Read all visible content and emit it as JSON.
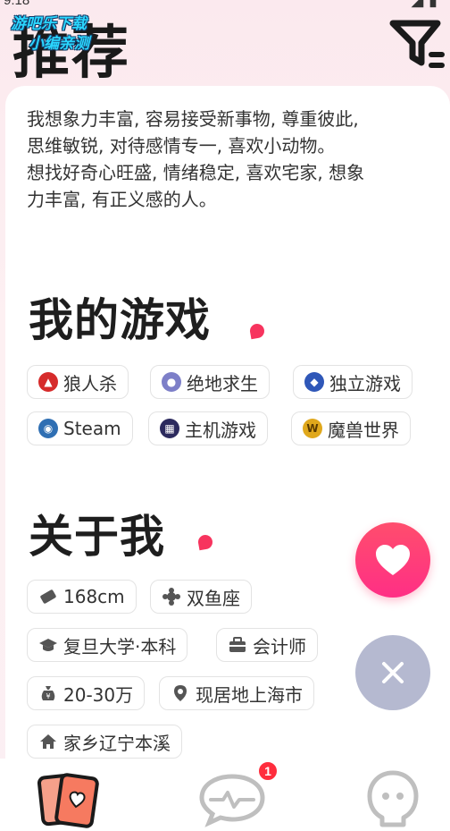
{
  "status_bar": {
    "time": "9:18"
  },
  "watermark": {
    "line1": "游吧乐下载",
    "line2": "小编亲测"
  },
  "header": {
    "title": "推荐"
  },
  "bio": {
    "line1": "我想象力丰富, 容易接受新事物, 尊重彼此,",
    "line2": "思维敏锐, 对待感情专一, 喜欢小动物。",
    "line3": "想找好奇心旺盛, 情绪稳定, 喜欢宅家, 想象",
    "line4": "力丰富, 有正义感的人。"
  },
  "games": {
    "title": "我的游戏",
    "tags": [
      {
        "label": "狼人杀",
        "icon": "werewolf-icon"
      },
      {
        "label": "绝地求生",
        "icon": "pubg-icon"
      },
      {
        "label": "独立游戏",
        "icon": "indie-game-icon"
      },
      {
        "label": "Steam",
        "icon": "steam-icon"
      },
      {
        "label": "主机游戏",
        "icon": "console-game-icon"
      },
      {
        "label": "魔兽世界",
        "icon": "warcraft-icon"
      }
    ]
  },
  "about": {
    "title": "关于我",
    "tags": [
      {
        "label": "168cm",
        "icon": "ruler-icon"
      },
      {
        "label": "双鱼座",
        "icon": "zodiac-icon"
      },
      {
        "label": "复旦大学·本科",
        "icon": "graduation-cap-icon"
      },
      {
        "label": "会计师",
        "icon": "briefcase-icon"
      },
      {
        "label": "20-30万",
        "icon": "money-bag-icon"
      },
      {
        "label": "现居地上海市",
        "icon": "location-pin-icon"
      },
      {
        "label": "家乡辽宁本溪",
        "icon": "home-icon"
      }
    ]
  },
  "actions": {
    "like_icon": "heart-icon",
    "pass_icon": "close-icon"
  },
  "tabbar": {
    "items": [
      {
        "name": "cards",
        "icon": "cards-icon",
        "active": true
      },
      {
        "name": "messages",
        "icon": "chat-pulse-icon",
        "badge": "1"
      },
      {
        "name": "profile",
        "icon": "ghost-icon"
      }
    ]
  },
  "colors": {
    "accent": "#f7345e",
    "like": "#ff3f78",
    "pass": "#b5b9d0",
    "badge": "#ff2d3d"
  }
}
